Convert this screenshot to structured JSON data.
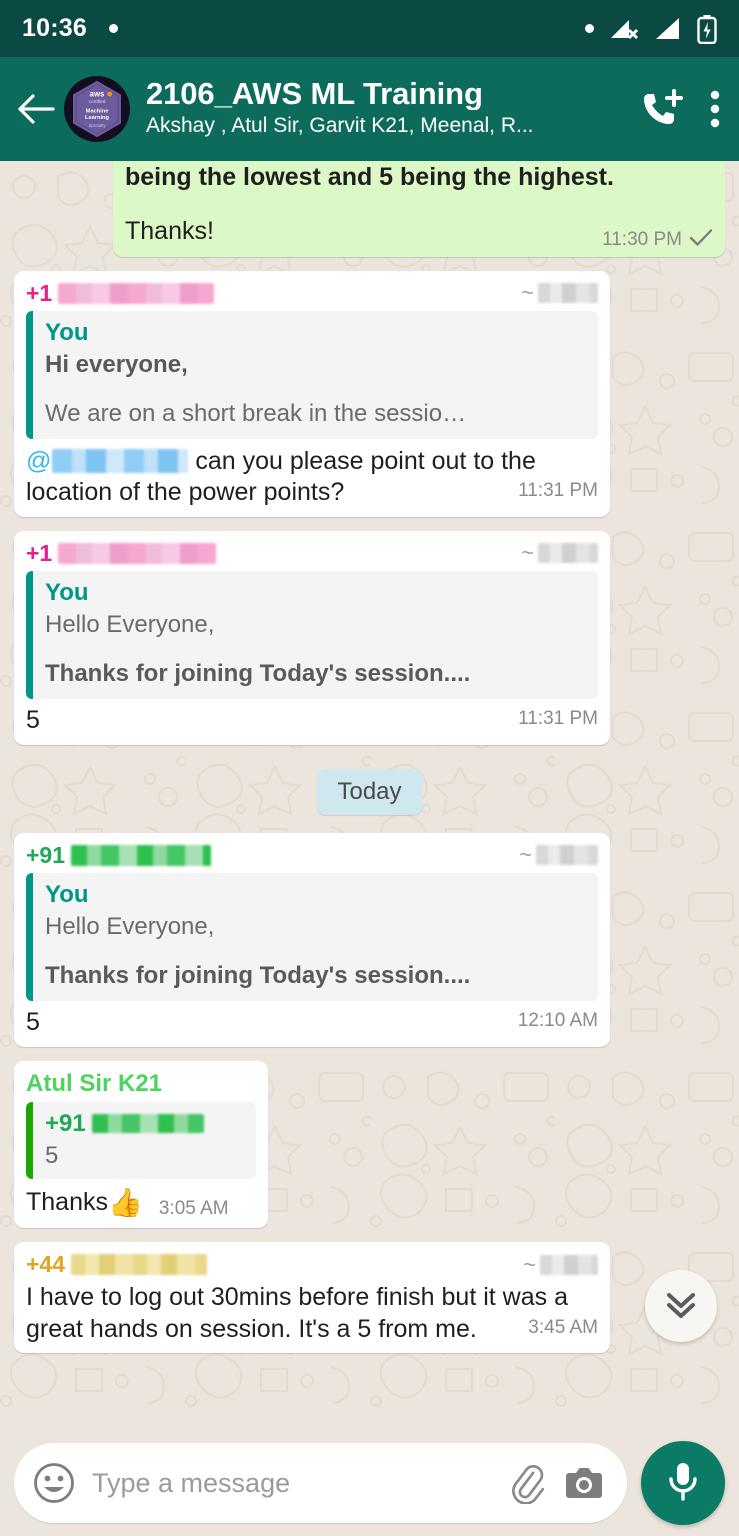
{
  "status_bar": {
    "time": "10:36",
    "icons": [
      "dot-icon",
      "signal-no-service-icon",
      "signal-bars-icon",
      "battery-charging-icon"
    ]
  },
  "header": {
    "back_icon": "back-arrow-icon",
    "avatar": "aws-certified-machine-learning-badge",
    "avatar_lines": [
      "aws",
      "certified",
      "Machine",
      "Learning",
      "Specialty"
    ],
    "title": "2106_AWS ML Training",
    "participants": "Akshay , Atul Sir, Garvit K21, Meenal, R...",
    "call_icon": "add-call-icon",
    "menu_icon": "overflow-menu-icon"
  },
  "chat": {
    "date_divider": "Today",
    "messages": [
      {
        "id": "msg-1",
        "side": "out",
        "cut_off": true,
        "lines": [
          "being the lowest and 5 being the highest.",
          "",
          "Thanks!"
        ],
        "time": "11:30 PM",
        "status": "sent-single-check"
      },
      {
        "id": "msg-2",
        "side": "in",
        "sender_prefix": "+1",
        "sender_redacted": true,
        "sender_color": "#E91E8C",
        "push_name_prefix": "~",
        "quote": {
          "author": "You",
          "author_color": "#009688",
          "bar_color": "#009688",
          "line1": "Hi everyone,",
          "line1_bold": true,
          "line2": "We are on a short break in the sessio…"
        },
        "mention_prefix": "@",
        "text_after_mention": " can you please point out to the location of the power points?",
        "time": "11:31 PM"
      },
      {
        "id": "msg-3",
        "side": "in",
        "sender_prefix": "+1",
        "sender_redacted": true,
        "sender_color": "#E91E8C",
        "push_name_prefix": "~",
        "quote": {
          "author": "You",
          "author_color": "#009688",
          "bar_color": "#009688",
          "line1": "Hello Everyone,",
          "line1_bold": false,
          "line2": "Thanks for joining Today's session....",
          "line2_bold": true
        },
        "body": "5",
        "time": "11:31 PM"
      },
      {
        "id": "msg-4",
        "side": "in",
        "sender_prefix": "+91",
        "sender_redacted": true,
        "sender_color": "#1FA855",
        "push_name_prefix": "~",
        "quote": {
          "author": "You",
          "author_color": "#009688",
          "bar_color": "#009688",
          "line1": "Hello Everyone,",
          "line1_bold": false,
          "line2": "Thanks for joining Today's session....",
          "line2_bold": true
        },
        "body": "5",
        "time": "12:10 AM"
      },
      {
        "id": "msg-5",
        "side": "in",
        "sender_name": "Atul Sir K21",
        "sender_color": "#4ED45E",
        "quote": {
          "author_prefix": "+91",
          "author_color": "#1FA855",
          "author_redacted": true,
          "bar_color": "#1CA800",
          "line1": "5"
        },
        "body": "Thanks ",
        "emoji": "👍",
        "time": "3:05 AM"
      },
      {
        "id": "msg-6",
        "side": "in",
        "sender_prefix": "+44",
        "sender_redacted": true,
        "sender_color": "#E0A526",
        "push_name_prefix": "~",
        "body": "I have to log out 30mins before finish but it was a great hands on session. It's a 5 from me.",
        "time": "3:45 AM"
      }
    ]
  },
  "scroll_button": {
    "icon": "double-chevron-down-icon"
  },
  "input_bar": {
    "emoji_icon": "smiley-face-icon",
    "placeholder": "Type a message",
    "attach_icon": "paperclip-icon",
    "camera_icon": "camera-icon",
    "mic_icon": "microphone-icon"
  },
  "colors": {
    "status_bar": "#0B4A42",
    "header": "#0D6B5C",
    "chat_background": "#ECE5DD",
    "outgoing_bubble": "#DCF8C6",
    "incoming_bubble": "#FFFFFF",
    "divider": "#CFE8F0",
    "mic_fab": "#0C7B66",
    "quote_teal": "#009688",
    "quote_green": "#1CA800"
  }
}
